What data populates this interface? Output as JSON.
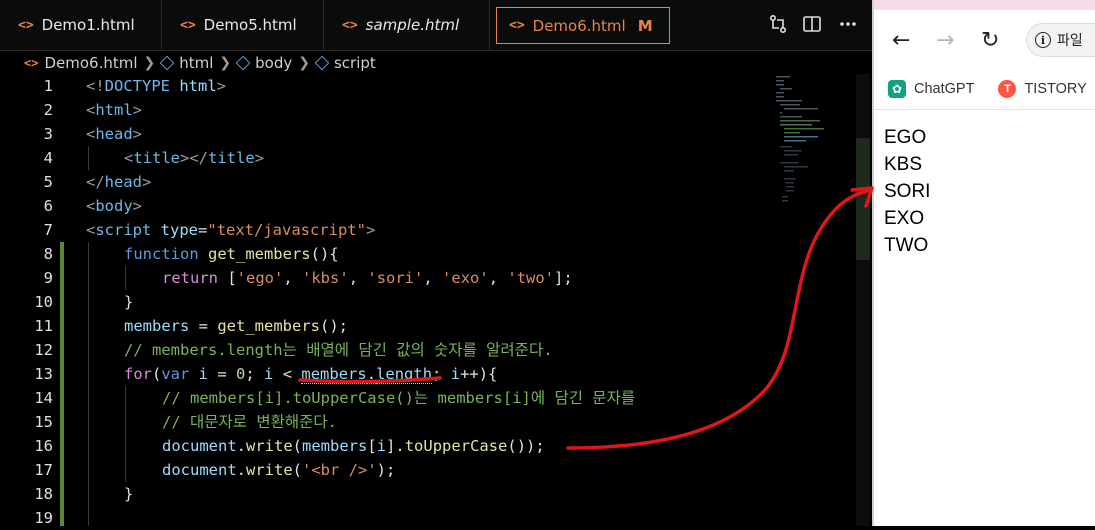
{
  "tabs": [
    {
      "label": "Demo1.html",
      "icon": "<>",
      "italic": false,
      "active": false,
      "modified": ""
    },
    {
      "label": "Demo5.html",
      "icon": "<>",
      "italic": false,
      "active": false,
      "modified": ""
    },
    {
      "label": "sample.html",
      "icon": "<>",
      "italic": true,
      "active": false,
      "modified": ""
    },
    {
      "label": "Demo6.html",
      "icon": "<>",
      "italic": false,
      "active": true,
      "modified": "M"
    }
  ],
  "breadcrumb": [
    "Demo6.html",
    "html",
    "body",
    "script"
  ],
  "code_lines": [
    {
      "n": "1"
    },
    {
      "n": "2"
    },
    {
      "n": "3"
    },
    {
      "n": "4"
    },
    {
      "n": "5"
    },
    {
      "n": "6"
    },
    {
      "n": "7"
    },
    {
      "n": "8"
    },
    {
      "n": "9"
    },
    {
      "n": "10"
    },
    {
      "n": "11"
    },
    {
      "n": "12"
    },
    {
      "n": "13"
    },
    {
      "n": "14"
    },
    {
      "n": "15"
    },
    {
      "n": "16"
    },
    {
      "n": "17"
    },
    {
      "n": "18"
    },
    {
      "n": "19"
    }
  ],
  "code": {
    "l1_a": "<!",
    "l1_b": "DOCTYPE",
    "l1_c": " html",
    "l1_d": ">",
    "l2_a": "<",
    "l2_b": "html",
    "l2_c": ">",
    "l3_a": "<",
    "l3_b": "head",
    "l3_c": ">",
    "l4_a": "<",
    "l4_b": "title",
    "l4_c": "></",
    "l4_d": "title",
    "l4_e": ">",
    "l5_a": "</",
    "l5_b": "head",
    "l5_c": ">",
    "l6_a": "<",
    "l6_b": "body",
    "l6_c": ">",
    "l7_a": "<",
    "l7_b": "script",
    "l7_c": " type",
    "l7_d": "=",
    "l7_e": "\"text/javascript\"",
    "l7_f": ">",
    "l8_a": "function",
    "l8_b": " get_members",
    "l8_c": "(){",
    "l9_a": "return",
    "l9_b": " [",
    "l9_s1": "'ego'",
    "l9_s2": "'kbs'",
    "l9_s3": "'sori'",
    "l9_s4": "'exo'",
    "l9_s5": "'two'",
    "l9_comma": ", ",
    "l9_end": "];",
    "l10": "}",
    "l11_a": "members",
    "l11_b": " = ",
    "l11_c": "get_members",
    "l11_d": "();",
    "l12": "// members.length는 배열에 담긴 값의 숫자를 알려준다.",
    "l13_a": "for",
    "l13_b": "(",
    "l13_c": "var",
    "l13_d": " i",
    "l13_e": " = ",
    "l13_f": "0",
    "l13_g": "; ",
    "l13_h": "i",
    "l13_i": " < ",
    "l13_j": "members",
    "l13_k": ".",
    "l13_l": "length",
    "l13_m": "; ",
    "l13_n": "i",
    "l13_o": "++){",
    "l14": "// members[i].toUpperCase()는 members[i]에 담긴 문자를",
    "l15": "// 대문자로 변환해준다.",
    "l16_a": "document",
    "l16_b": ".",
    "l16_c": "write",
    "l16_d": "(",
    "l16_e": "members",
    "l16_f": "[",
    "l16_g": "i",
    "l16_h": "].",
    "l16_i": "toUpperCase",
    "l16_j": "());",
    "l17_a": "document",
    "l17_b": ".",
    "l17_c": "write",
    "l17_d": "(",
    "l17_e": "'<br />'",
    "l17_f": ");",
    "l18": "}"
  },
  "browser": {
    "back": "←",
    "forward": "→",
    "reload": "↻",
    "address_text": "파일",
    "info_glyph": "i",
    "bookmarks": [
      {
        "label": "ChatGPT",
        "icon": "chatgpt-icon"
      },
      {
        "label": "TISTORY",
        "icon": "tistory-icon"
      }
    ],
    "output": [
      "EGO",
      "KBS",
      "SORI",
      "EXO",
      "TWO"
    ]
  },
  "colors": {
    "accent": "#e8834a",
    "annotation": "#e0171a",
    "comment": "#7bb358",
    "keyword": "#5a9be0"
  }
}
